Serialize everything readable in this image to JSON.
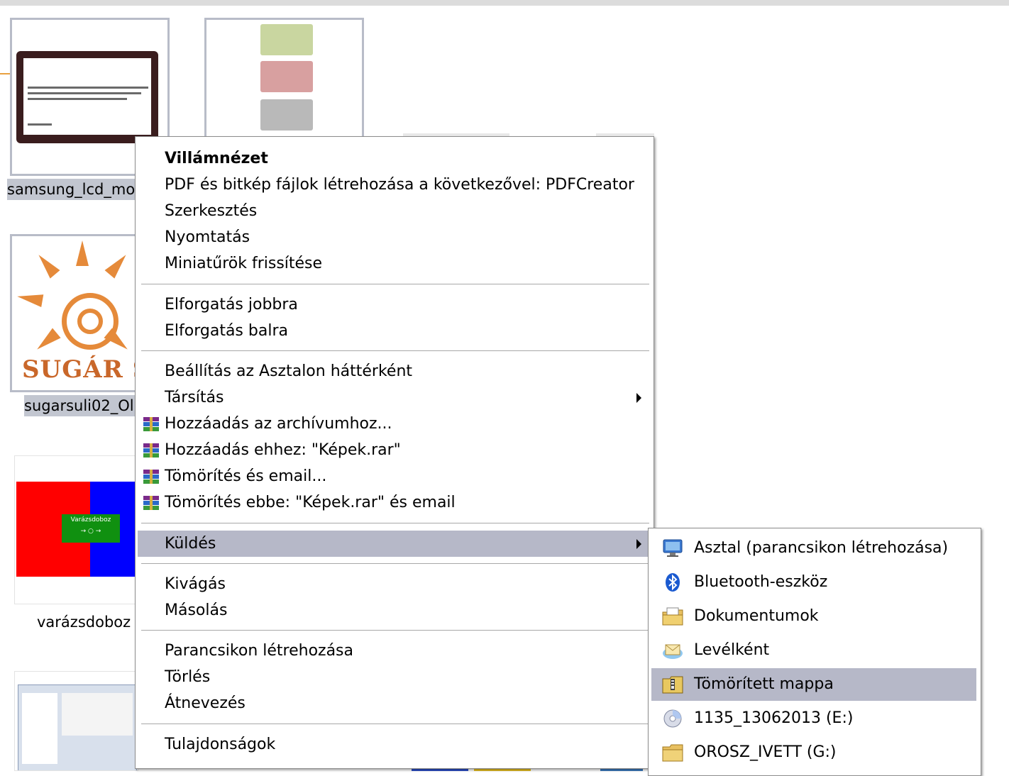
{
  "thumbnails": [
    {
      "caption": "samsung_lcd_mo"
    },
    {
      "caption": ""
    },
    {
      "caption": "sugarsuli02_Ol"
    },
    {
      "caption": "varázsdoboz"
    },
    {
      "caption": ""
    }
  ],
  "sugar_logo_text": "SUGÁR SU",
  "varazs_box_text": "Varázsdoboz",
  "context_menu": {
    "items": [
      {
        "label": "Villámnézet"
      },
      {
        "label": "PDF és bitkép fájlok létrehozása a következővel: PDFCreator"
      },
      {
        "label": "Szerkesztés"
      },
      {
        "label": "Nyomtatás"
      },
      {
        "label": "Miniatűrök frissítése"
      },
      {
        "label": "Elforgatás jobbra"
      },
      {
        "label": "Elforgatás balra"
      },
      {
        "label": "Beállítás az Asztalon háttérként"
      },
      {
        "label": "Társítás"
      },
      {
        "label": "Hozzáadás az archívumhoz..."
      },
      {
        "label": "Hozzáadás ehhez: \"Képek.rar\""
      },
      {
        "label": "Tömörítés és email..."
      },
      {
        "label": "Tömörítés ebbe: \"Képek.rar\" és email"
      },
      {
        "label": "Küldés"
      },
      {
        "label": "Kivágás"
      },
      {
        "label": "Másolás"
      },
      {
        "label": "Parancsikon létrehozása"
      },
      {
        "label": "Törlés"
      },
      {
        "label": "Átnevezés"
      },
      {
        "label": "Tulajdonságok"
      }
    ]
  },
  "send_to_menu": {
    "items": [
      {
        "label": "Asztal (parancsikon létrehozása)",
        "icon": "desktop-icon"
      },
      {
        "label": "Bluetooth-eszköz",
        "icon": "bluetooth-icon"
      },
      {
        "label": "Dokumentumok",
        "icon": "documents-folder-icon"
      },
      {
        "label": "Levélként",
        "icon": "mail-icon"
      },
      {
        "label": "Tömörített mappa",
        "icon": "zip-folder-icon"
      },
      {
        "label": "1135_13062013 (E:)",
        "icon": "cd-drive-icon"
      },
      {
        "label": "OROSZ_IVETT (G:)",
        "icon": "folder-icon"
      }
    ]
  },
  "colors": {
    "highlight": "#b6b8c8",
    "selection_border": "#b8bcc8",
    "menu_border": "#8c8c8c"
  }
}
